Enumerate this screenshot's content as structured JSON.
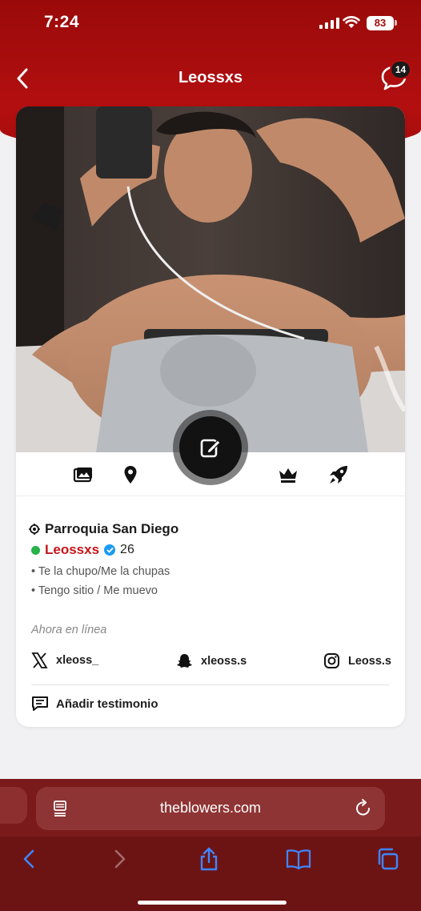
{
  "status_bar": {
    "time": "7:24",
    "battery": "83"
  },
  "header": {
    "title": "Leossxs",
    "chat_badge": "14",
    "accent": "#b30f10"
  },
  "profile": {
    "location": "Parroquia San Diego",
    "username": "Leossxs",
    "age": "26",
    "bio": [
      "• Te la chupo/Me la chupas",
      "• Tengo sitio / Me muevo"
    ],
    "status": "Ahora en línea",
    "socials": [
      {
        "icon": "x-icon",
        "handle": "xleoss_"
      },
      {
        "icon": "snapchat-icon",
        "handle": "xleoss.s"
      },
      {
        "icon": "instagram-icon",
        "handle": "Leoss.s"
      }
    ],
    "testimonial_label": "Añadir testimonio"
  },
  "icon_row": [
    "photos-icon",
    "location-pin-icon",
    "crown-icon",
    "rocket-icon"
  ],
  "browser": {
    "url": "theblowers.com"
  }
}
